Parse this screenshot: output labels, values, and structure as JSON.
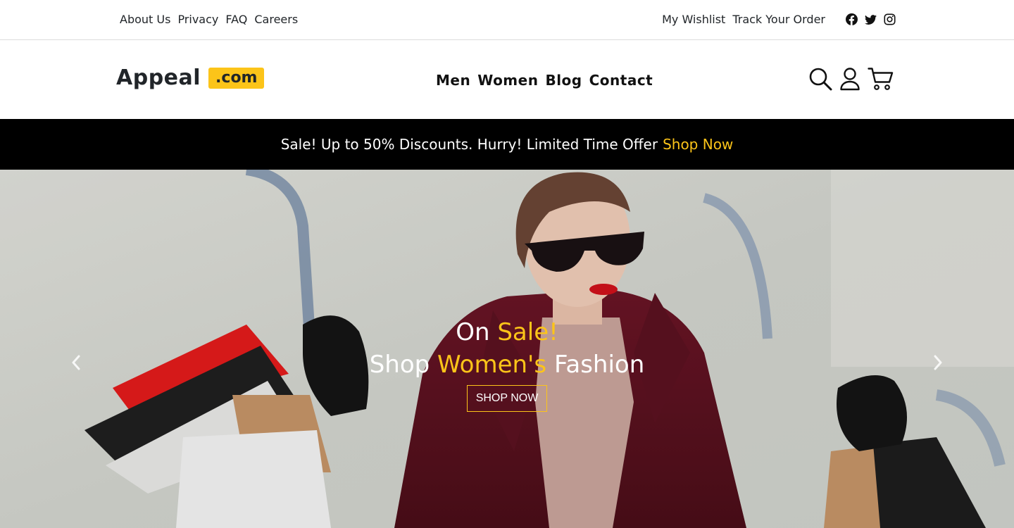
{
  "topbar": {
    "left_links": [
      "About Us",
      "Privacy",
      "FAQ",
      "Careers"
    ],
    "right_links": [
      "My Wishlist",
      "Track Your Order"
    ],
    "social_icons": [
      "facebook-icon",
      "twitter-icon",
      "instagram-icon"
    ]
  },
  "header": {
    "logo_main": "Appeal",
    "logo_tld": ".com",
    "nav": [
      "Men",
      "Women",
      "Blog",
      "Contact"
    ],
    "icons": [
      "search-icon",
      "user-icon",
      "cart-icon"
    ]
  },
  "sale": {
    "text": "Sale! Up to 50% Discounts. Hurry! Limited Time Offer",
    "link": "Shop Now"
  },
  "hero": {
    "line1_a": "On",
    "line1_b": "Sale!",
    "line2_a": "Shop",
    "line2_b": "Women's",
    "line2_c": "Fashion",
    "button": "SHOP NOW",
    "prev_icon": "chevron-left-icon",
    "next_icon": "chevron-right-icon"
  },
  "colors": {
    "accent": "#fcc419",
    "banner_bg": "#000000",
    "text": "#212529"
  }
}
